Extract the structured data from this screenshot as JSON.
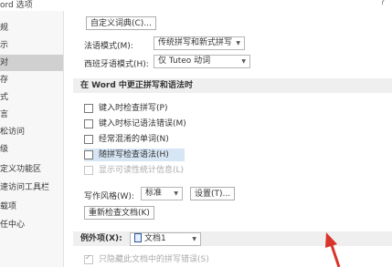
{
  "window": {
    "title": "ord 选项",
    "help_glyph": "?"
  },
  "sidebar": {
    "items": [
      {
        "label": "规"
      },
      {
        "label": "示"
      },
      {
        "label": "对",
        "selected": true
      },
      {
        "label": "存"
      },
      {
        "label": "式"
      },
      {
        "label": "言"
      },
      {
        "label": "松访问"
      },
      {
        "label": "级"
      },
      {
        "label": "定义功能区"
      },
      {
        "label": "速访问工具栏"
      },
      {
        "label": "载项"
      },
      {
        "label": "任中心"
      }
    ]
  },
  "content": {
    "custom_dictionary_button": "自定义词典(C)...",
    "french_modes_label": "法语模式(M):",
    "french_modes_value": "传统拼写和新式拼写",
    "spanish_modes_label": "西班牙语模式(H):",
    "spanish_modes_value": "仅 Tuteo 动词",
    "section_title": "在 Word 中更正拼写和语法时",
    "checkboxes": [
      {
        "label": "键入时检查拼写(P)",
        "checked": false,
        "disabled": false
      },
      {
        "label": "键入时标记语法错误(M)",
        "checked": false,
        "disabled": false
      },
      {
        "label": "经常混淆的单词(N)",
        "checked": false,
        "disabled": false
      },
      {
        "label": "随拼写检查语法(H)",
        "checked": false,
        "disabled": false,
        "highlighted": true
      },
      {
        "label": "显示可读性统计信息(L)",
        "checked": false,
        "disabled": true
      }
    ],
    "writing_style_label": "写作风格(W):",
    "writing_style_value": "标准",
    "settings_button": "设置(T)...",
    "recheck_button": "重新检查文档(K)",
    "exceptions_label": "例外项(X):",
    "exceptions_value": "文档1",
    "hide_spelling_errors_label": "只隐藏此文档中的拼写错误(S)",
    "accent_color": "#d9342b"
  }
}
